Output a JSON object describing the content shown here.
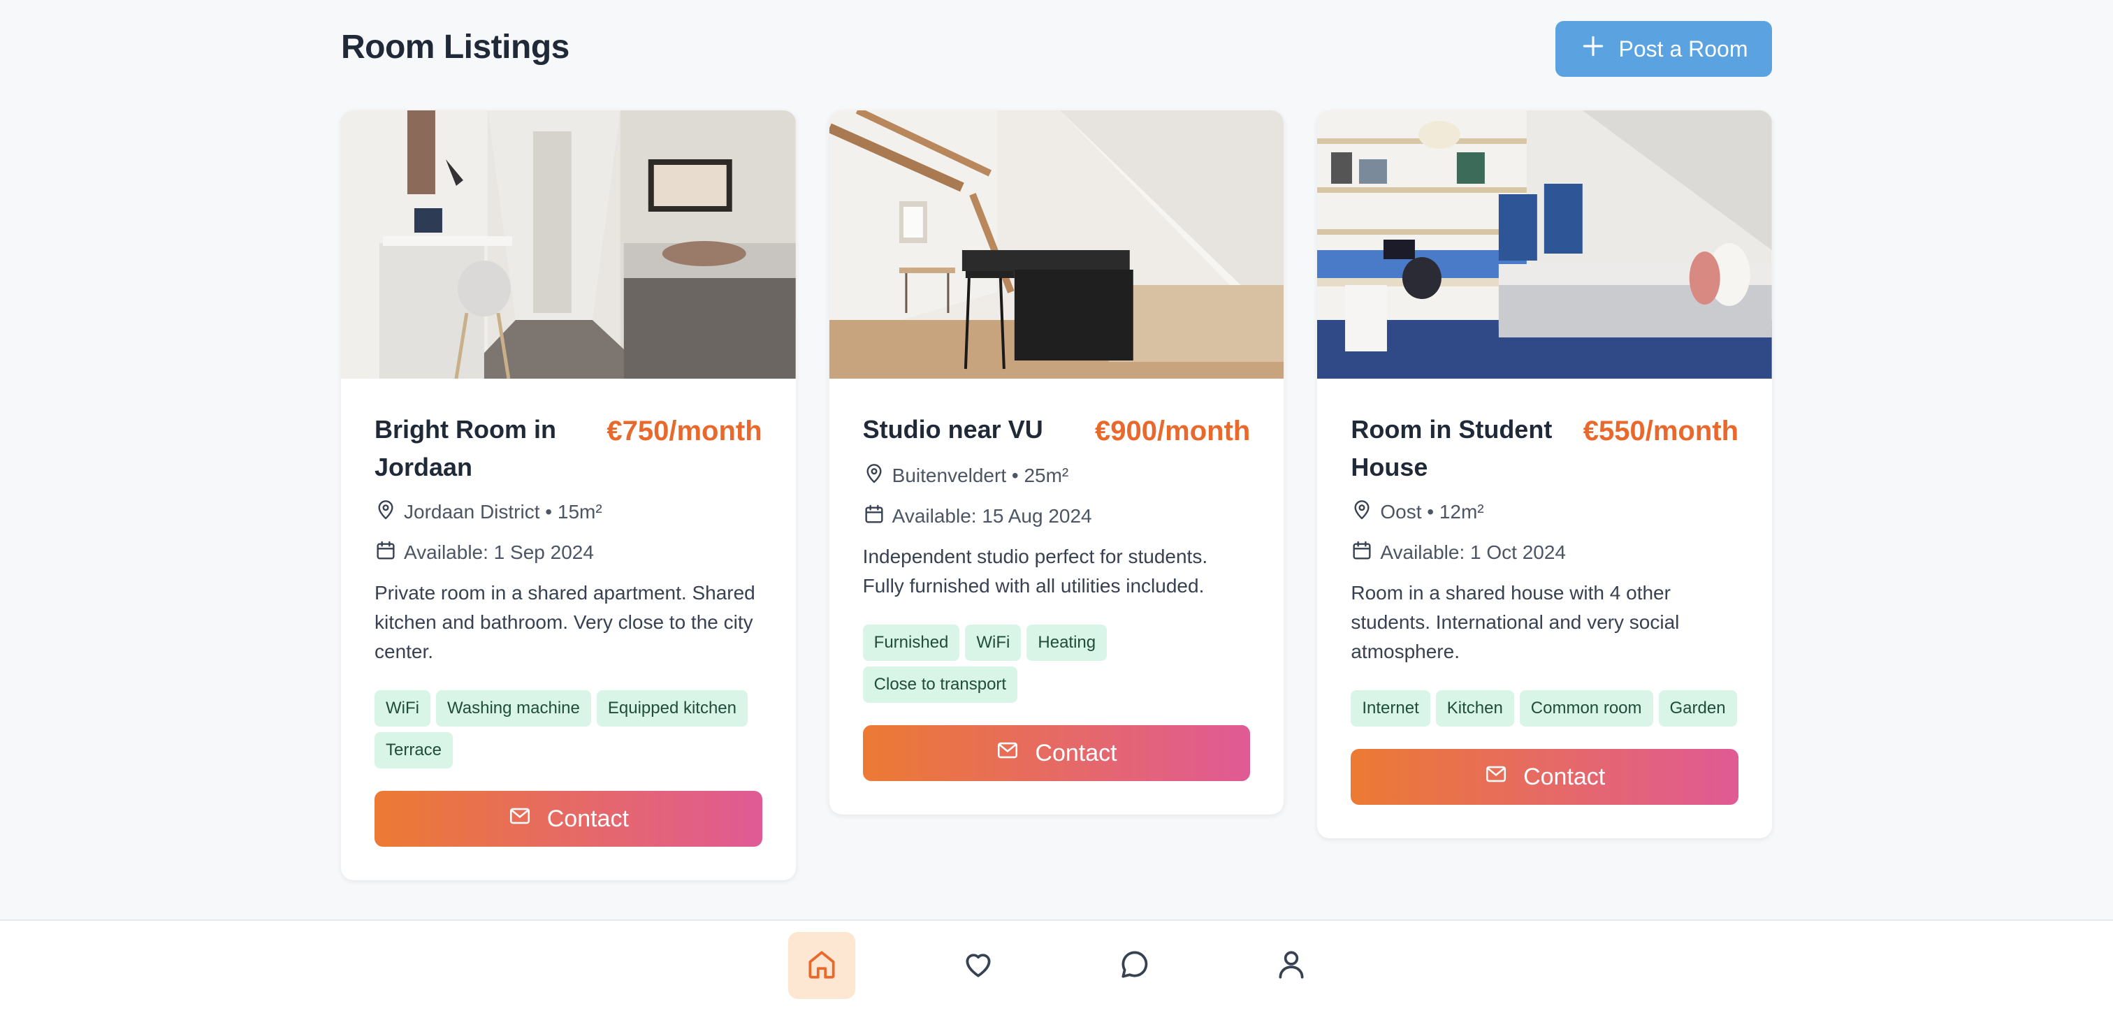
{
  "header": {
    "title": "Room Listings",
    "post_button_label": "Post a Room"
  },
  "listings": [
    {
      "title": "Bright Room in Jordaan",
      "price": "€750/month",
      "location": "Jordaan District • 15m²",
      "available": "Available: 1 Sep 2024",
      "description": "Private room in a shared apartment. Shared kitchen and bathroom. Very close to the city center.",
      "tags": [
        "WiFi",
        "Washing machine",
        "Equipped kitchen",
        "Terrace"
      ],
      "contact_label": "Contact"
    },
    {
      "title": "Studio near VU",
      "price": "€900/month",
      "location": "Buitenveldert • 25m²",
      "available": "Available: 15 Aug 2024",
      "description": "Independent studio perfect for students. Fully furnished with all utilities included.",
      "tags": [
        "Furnished",
        "WiFi",
        "Heating",
        "Close to transport"
      ],
      "contact_label": "Contact"
    },
    {
      "title": "Room in Student House",
      "price": "€550/month",
      "location": "Oost • 12m²",
      "available": "Available: 1 Oct 2024",
      "description": "Room in a shared house with 4 other students. International and very social atmosphere.",
      "tags": [
        "Internet",
        "Kitchen",
        "Common room",
        "Garden"
      ],
      "contact_label": "Contact"
    }
  ],
  "bottom_nav": [
    {
      "icon": "home-icon",
      "active": true
    },
    {
      "icon": "heart-icon",
      "active": false
    },
    {
      "icon": "chat-icon",
      "active": false
    },
    {
      "icon": "user-icon",
      "active": false
    }
  ],
  "colors": {
    "accent_price": "#e8692b",
    "post_button": "#5aa3e0",
    "contact_gradient_start": "#ec7a33",
    "contact_gradient_end": "#e05a95",
    "tag_background": "#d9f5e8",
    "nav_active_background": "#fde6d2"
  }
}
